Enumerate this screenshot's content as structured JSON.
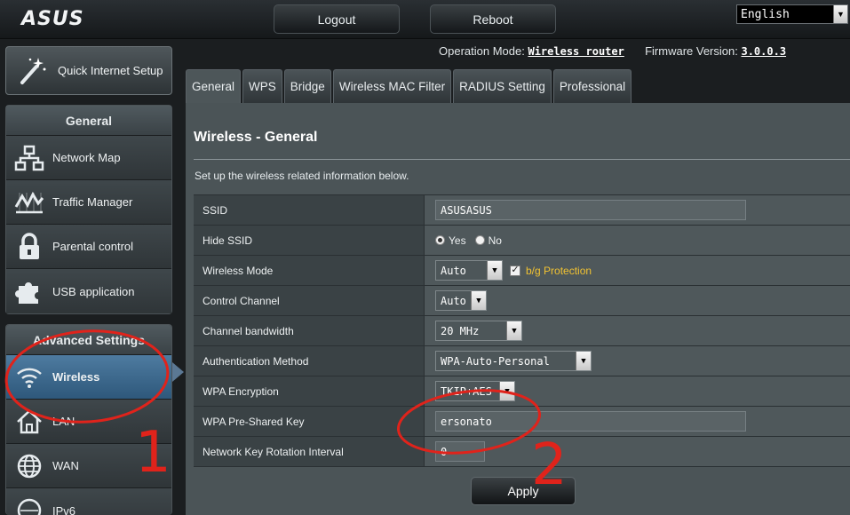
{
  "brand": {
    "logo_text": "ASUS"
  },
  "header": {
    "logout_label": "Logout",
    "reboot_label": "Reboot",
    "language": "English",
    "operation_mode_label": "Operation Mode:",
    "operation_mode_value": "Wireless router",
    "firmware_label": "Firmware Version:",
    "firmware_value": "3.0.0.3"
  },
  "sidebar": {
    "quick_setup_label": "Quick Internet Setup",
    "general_heading": "General",
    "general_items": [
      {
        "label": "Network Map",
        "icon": "network-map-icon"
      },
      {
        "label": "Traffic Manager",
        "icon": "traffic-manager-icon"
      },
      {
        "label": "Parental control",
        "icon": "lock-icon"
      },
      {
        "label": "USB application",
        "icon": "puzzle-icon"
      }
    ],
    "advanced_heading": "Advanced Settings",
    "advanced_items": [
      {
        "label": "Wireless",
        "icon": "wifi-icon",
        "active": true
      },
      {
        "label": "LAN",
        "icon": "home-icon"
      },
      {
        "label": "WAN",
        "icon": "globe-icon"
      },
      {
        "label": "IPv6",
        "icon": "ipv6-icon"
      }
    ]
  },
  "tabs": [
    "General",
    "WPS",
    "Bridge",
    "Wireless MAC Filter",
    "RADIUS Setting",
    "Professional"
  ],
  "main": {
    "title": "Wireless - General",
    "description": "Set up the wireless related information below.",
    "fields": {
      "ssid": {
        "label": "SSID",
        "value": "ASUSASUS"
      },
      "hide_ssid": {
        "label": "Hide SSID",
        "yes": "Yes",
        "no": "No",
        "selected": "Yes"
      },
      "wireless_mode": {
        "label": "Wireless Mode",
        "value": "Auto",
        "bg_protection_label": "b/g Protection",
        "bg_protection_checked": true
      },
      "control_channel": {
        "label": "Control Channel",
        "value": "Auto"
      },
      "channel_bandwidth": {
        "label": "Channel bandwidth",
        "value": "20 MHz"
      },
      "auth_method": {
        "label": "Authentication Method",
        "value": "WPA-Auto-Personal"
      },
      "wpa_encryption": {
        "label": "WPA Encryption",
        "value": "TKIP+AES"
      },
      "wpa_psk": {
        "label": "WPA Pre-Shared Key",
        "value": "ersonato"
      },
      "key_rotation": {
        "label": "Network Key Rotation Interval",
        "value": "0"
      }
    },
    "apply_label": "Apply"
  },
  "annotations": {
    "marker_1": "1",
    "marker_2": "2",
    "color": "#e0231b"
  },
  "colors": {
    "active_nav": "#3f6b90",
    "bg_protection": "#f1c232"
  }
}
